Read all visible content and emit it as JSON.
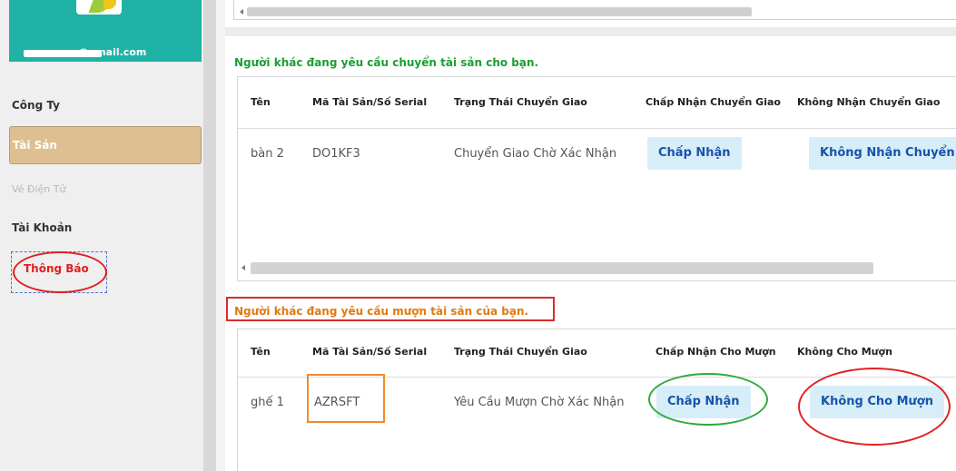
{
  "sidebar": {
    "user_email": "ng@gmail.com",
    "items": [
      {
        "label": "Công Ty"
      },
      {
        "label": "Tài Sản"
      },
      {
        "label": "Vé Điện Tử"
      },
      {
        "label": "Tài Khoản"
      },
      {
        "label": "Thông Báo"
      }
    ]
  },
  "transfer_section": {
    "title": "Người khác đang yêu cầu chuyển tài sản cho bạn.",
    "columns": [
      "Tên",
      "Mã Tài Sản/Số Serial",
      "Trạng Thái Chuyển Giao",
      "Chấp Nhận Chuyển Giao",
      "Không Nhận Chuyển Giao"
    ],
    "rows": [
      {
        "name": "bàn 2",
        "serial": "DO1KF3",
        "status": "Chuyển Giao Chờ Xác Nhận",
        "accept_label": "Chấp Nhận",
        "reject_label": "Không Nhận Chuyển Giao"
      }
    ]
  },
  "borrow_section": {
    "title": "Người khác đang yêu cầu mượn tài sản của bạn.",
    "columns": [
      "Tên",
      "Mã Tài Sản/Số Serial",
      "Trạng Thái Chuyển Giao",
      "Chấp Nhận Cho Mượn",
      "Không Cho Mượn"
    ],
    "rows": [
      {
        "name": "ghế 1",
        "serial": "AZRSFT",
        "status": "Yêu Cầu Mượn Chờ Xác Nhận",
        "accept_label": "Chấp Nhận",
        "reject_label": "Không Cho Mượn"
      }
    ]
  },
  "colors": {
    "sidebar_header": "#1fb3a7",
    "active_nav": "#ddbf91",
    "transfer_title": "#1a9f31",
    "borrow_title": "#e07a10",
    "button_bg": "#d7eef9",
    "button_text": "#1753a8",
    "annotation_red": "#e02020",
    "annotation_green": "#2daa3b",
    "annotation_orange": "#f08a2a"
  }
}
